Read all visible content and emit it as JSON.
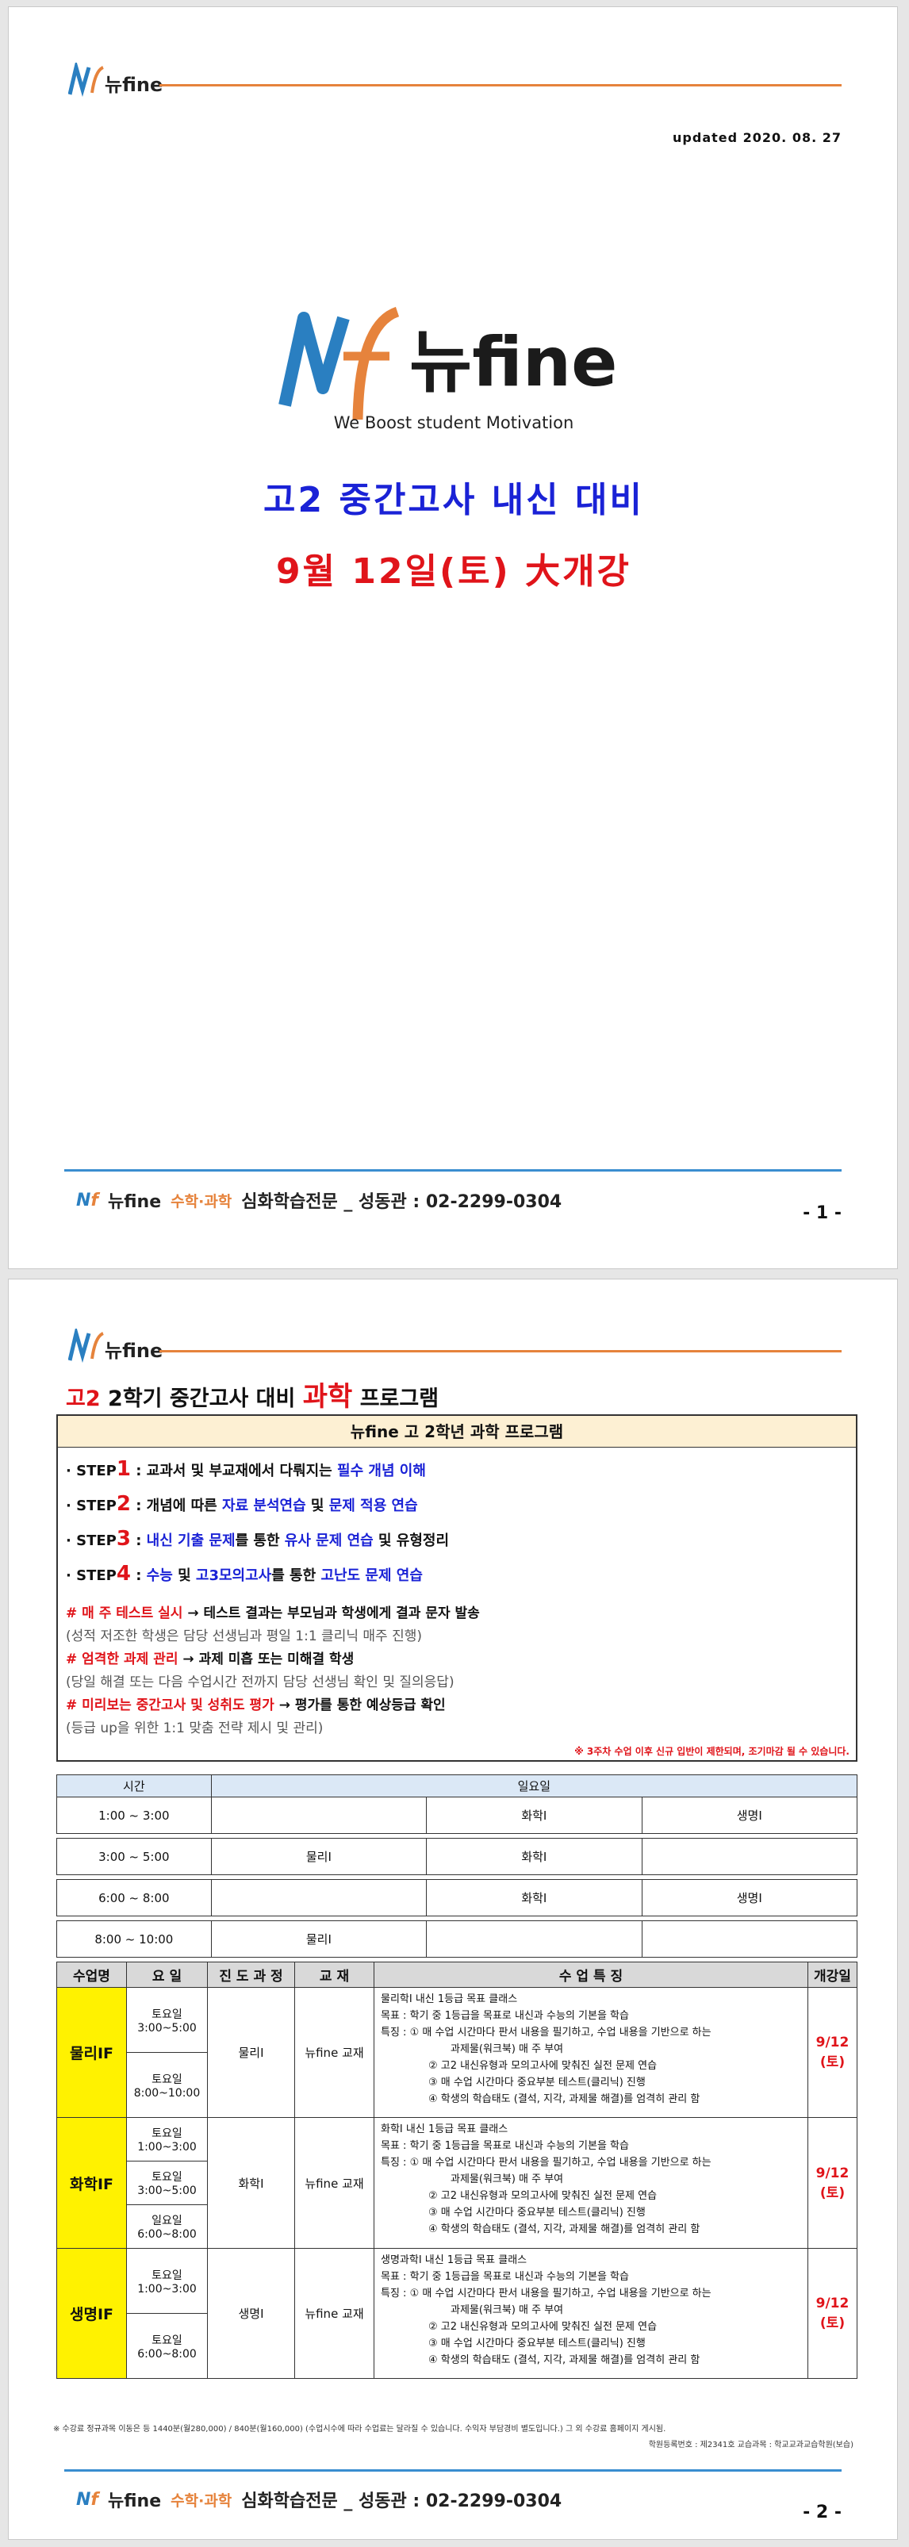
{
  "brand": {
    "n": "N",
    "f": "f",
    "name": "뉴fine",
    "sub": "수학·과학",
    "tagline": "We Boost student Motivation"
  },
  "page1": {
    "updated": "updated 2020. 08. 27",
    "title1": "고2  중간고사  내신  대비",
    "title2": "9월  12일(토)  大개강",
    "footer": "심화학습전문 _ 성동관 : 02-2299-0304",
    "page_num": "- 1 -"
  },
  "page2": {
    "title_prefix": "고2",
    "title_mid": " 2학기 중간고사 대비 ",
    "title_key": "과학",
    "title_suffix": " 프로그램",
    "box_header": "뉴fine 고 2학년 과학 프로그램",
    "steps": [
      {
        "pre": "· STEP",
        "num": "1",
        "a": " : 교과서 및 부교재에서 다뤄지는 ",
        "b": "필수 개념 이해",
        "c": "",
        "d": "",
        "e": "",
        "f": ""
      },
      {
        "pre": "· STEP",
        "num": "2",
        "a": " : 개념에 따른 ",
        "b": "자료 분석연습",
        "c": " 및 ",
        "d": "문제 적용 연습",
        "e": "",
        "f": ""
      },
      {
        "pre": "· STEP",
        "num": "3",
        "a": " : ",
        "b": "내신 기출 문제",
        "c": "를 통한 ",
        "d": "유사 문제 연습",
        "e": " 및 유형정리",
        "f": ""
      },
      {
        "pre": "· STEP",
        "num": "4",
        "a": " : ",
        "b": "수능",
        "c": " 및 ",
        "d": "고3모의고사",
        "e": "를 통한 ",
        "f": "고난도 문제 연습"
      }
    ],
    "notes": [
      {
        "mark": "# ",
        "key": "매 주 테스트 실시",
        "rest": " → 테스트 결과는 부모님과 학생에게 결과 문자 발송"
      },
      {
        "sub": "(성적 저조한 학생은 담당 선생님과 평일 1:1 클리닉 매주 진행)"
      },
      {
        "mark": "# ",
        "key": "엄격한 과제 관리",
        "rest": " → 과제 미흡 또는 미해결 학생"
      },
      {
        "sub": "(당일 해결 또는 다음 수업시간 전까지 담당 선생님 확인 및 질의응답)"
      },
      {
        "mark": "# ",
        "key": "미리보는 중간고사 및 성취도 평가",
        "rest": " → 평가를 통한 예상등급 확인"
      },
      {
        "sub": "(등급 up을 위한 1:1 맞춤 전략 제시 및 관리)"
      }
    ],
    "notice": "※ 3주차 수업 이후 신규 입반이 제한되며, 조기마감 될 수 있습니다.",
    "timetable": {
      "h_time": "시간",
      "h_day": "일요일",
      "rows": [
        {
          "time": "1:00 ~ 3:00",
          "c1": "",
          "c2": "화학Ⅰ",
          "c3": "생명Ⅰ"
        },
        {
          "time": "3:00 ~ 5:00",
          "c1": "물리Ⅰ",
          "c2": "화학Ⅰ",
          "c3": ""
        },
        {
          "time": "6:00 ~ 8:00",
          "c1": "",
          "c2": "화학Ⅰ",
          "c3": "생명Ⅰ"
        },
        {
          "time": "8:00 ~ 10:00",
          "c1": "물리Ⅰ",
          "c2": "",
          "c3": ""
        }
      ]
    },
    "course_headers": [
      "수업명",
      "요 일",
      "진 도 과 정",
      "교 재",
      "수 업 특 징",
      "개강일"
    ],
    "courses": [
      {
        "name": "물리ⅠF",
        "days": [
          "토요일 3:00~5:00",
          "토요일 8:00~10:00"
        ],
        "prog": "물리Ⅰ",
        "book": "뉴fine 교재",
        "feat": [
          "물리학Ⅰ 내신 1등급 목표 클래스",
          "목표 : 학기 중 1등급을 목표로 내신과 수능의 기본을 학습",
          "특징 : ① 매 수업 시간마다 판서 내용을 필기하고, 수업 내용을 기반으로 하는",
          "과제물(워크북) 매 주 부여",
          "② 고2 내신유형과 모의고사에 맞춰진 실전 문제 연습",
          "③ 매 수업 시간마다 중요부분 테스트(클리닉) 진행",
          "④ 학생의 학습태도 (결석, 지각, 과제물 해결)를 엄격히 관리 함"
        ],
        "open1": "9/12",
        "open2": "(토)"
      },
      {
        "name": "화학ⅠF",
        "days": [
          "토요일 1:00~3:00",
          "토요일 3:00~5:00",
          "일요일 6:00~8:00"
        ],
        "prog": "화학Ⅰ",
        "book": "뉴fine 교재",
        "feat": [
          "화학Ⅰ 내신 1등급 목표 클래스",
          "목표 : 학기 중 1등급을 목표로 내신과 수능의 기본을 학습",
          "특징 : ① 매 수업 시간마다 판서 내용을 필기하고, 수업 내용을 기반으로 하는",
          "과제물(워크북) 매 주 부여",
          "② 고2 내신유형과 모의고사에 맞춰진 실전 문제 연습",
          "③ 매 수업 시간마다 중요부분 테스트(클리닉) 진행",
          "④ 학생의 학습태도 (결석, 지각, 과제물 해결)를 엄격히 관리 함"
        ],
        "open1": "9/12",
        "open2": "(토)"
      },
      {
        "name": "생명ⅠF",
        "days": [
          "토요일 1:00~3:00",
          "토요일 6:00~8:00"
        ],
        "prog": "생명Ⅰ",
        "book": "뉴fine 교재",
        "feat": [
          "생명과학Ⅰ 내신 1등급 목표 클래스",
          "목표 : 학기 중 1등급을 목표로 내신과 수능의 기본을 학습",
          "특징 : ① 매 수업 시간마다 판서 내용을 필기하고, 수업 내용을 기반으로 하는",
          "과제물(워크북) 매 주 부여",
          "② 고2 내신유형과 모의고사에 맞춰진 실전 문제 연습",
          "③ 매 수업 시간마다 중요부분 테스트(클리닉) 진행",
          "④ 학생의 학습태도 (결석, 지각, 과제물 해결)를 엄격히 관리 함"
        ],
        "open1": "9/12",
        "open2": "(토)"
      }
    ],
    "foot_note": "※  수강료 정규과목 이동은 등 1440분(월280,000) / 840분(월160,000)  (수업시수에 따라 수업료는 달라질 수 있습니다. 수익자 부담경비 별도입니다.)   그 외 수강료 홈페이지 게시됨.",
    "foot_reg": "학원등록번호 : 제2341호 교습과목 : 학교교과교습학원(보습)",
    "footer": "심화학습전문 _ 성동관 : 02-2299-0304",
    "page_num": "- 2 -"
  }
}
